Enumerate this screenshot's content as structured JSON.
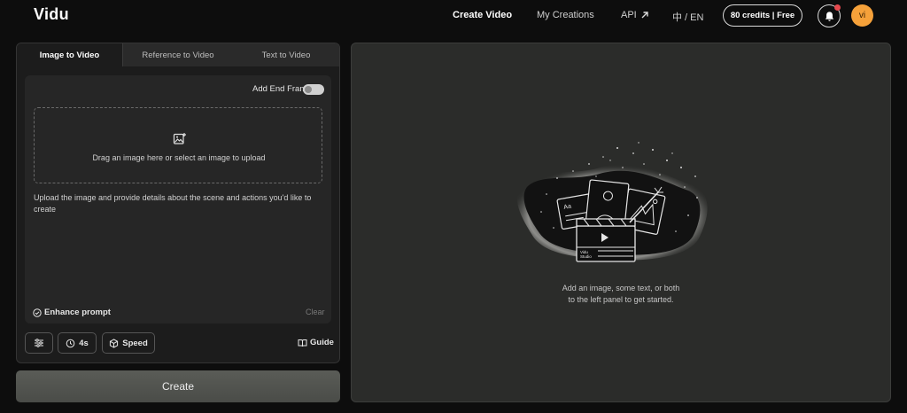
{
  "header": {
    "logo": "Vidu",
    "nav": {
      "create_video": "Create Video",
      "my_creations": "My Creations",
      "api": "API",
      "language": "中 / EN"
    },
    "credits": "80 credits | Free",
    "avatar_initials": "vi"
  },
  "tabs": {
    "image_to_video": "Image to Video",
    "reference_to_video": "Reference to Video",
    "text_to_video": "Text to Video"
  },
  "input": {
    "add_end_frame": "Add End Frame",
    "upload_text": "Drag an image here or select an image to upload",
    "prompt_placeholder": "Upload the image and provide details about the scene and actions you'd like to create",
    "enhance_prompt": "Enhance prompt",
    "clear": "Clear"
  },
  "toolbar": {
    "duration": "4s",
    "speed": "Speed",
    "guide": "Guide"
  },
  "create_button": "Create",
  "preview": {
    "empty_line1": "Add an image, some text, or both",
    "empty_line2": "to the left panel to get started.",
    "illustration_label1": "Vidu",
    "illustration_label2": "Studio"
  },
  "colors": {
    "background": "#0d0d0d",
    "panel": "#1c1c1c",
    "accent_avatar": "#f5a13a",
    "notification_dot": "#e5484d",
    "create_button": "#52544f"
  }
}
